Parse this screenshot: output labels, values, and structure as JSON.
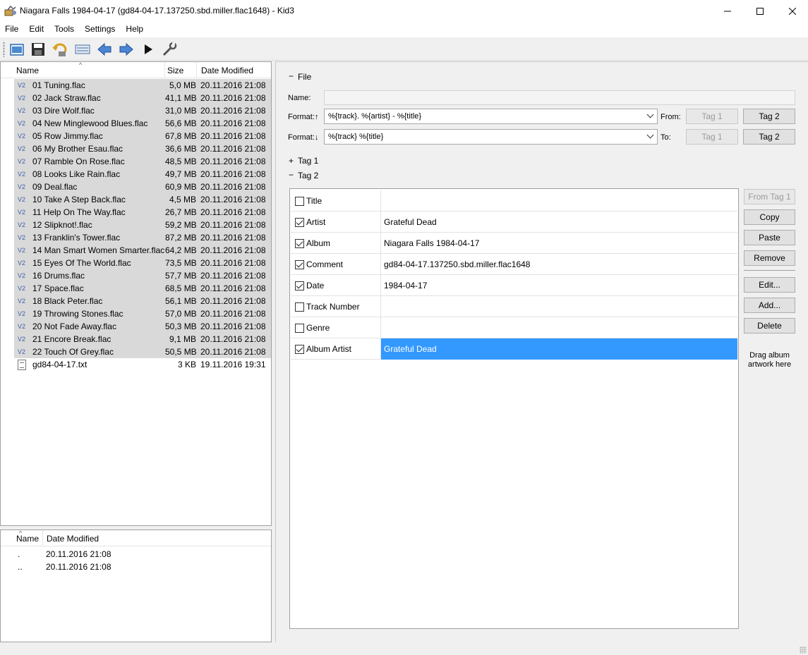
{
  "window": {
    "title": "Niagara Falls 1984-04-17 (gd84-04-17.137250.sbd.miller.flac1648) - Kid3"
  },
  "menu": [
    "File",
    "Edit",
    "Tools",
    "Settings",
    "Help"
  ],
  "toolbar": {
    "icons": [
      "open-icon",
      "save-icon",
      "revert-icon",
      "toggle-view-icon",
      "previous-icon",
      "next-icon",
      "play-icon",
      "settings-icon"
    ]
  },
  "file_list": {
    "columns": [
      "Name",
      "Size",
      "Date Modified"
    ],
    "rows": [
      {
        "tag": "V2",
        "name": "01 Tuning.flac",
        "size": "5,0 MB",
        "date": "20.11.2016 21:08"
      },
      {
        "tag": "V2",
        "name": "02 Jack Straw.flac",
        "size": "41,1 MB",
        "date": "20.11.2016 21:08"
      },
      {
        "tag": "V2",
        "name": "03 Dire Wolf.flac",
        "size": "31,0 MB",
        "date": "20.11.2016 21:08"
      },
      {
        "tag": "V2",
        "name": "04 New Minglewood Blues.flac",
        "size": "56,6 MB",
        "date": "20.11.2016 21:08"
      },
      {
        "tag": "V2",
        "name": "05 Row Jimmy.flac",
        "size": "67,8 MB",
        "date": "20.11.2016 21:08"
      },
      {
        "tag": "V2",
        "name": "06 My Brother Esau.flac",
        "size": "36,6 MB",
        "date": "20.11.2016 21:08"
      },
      {
        "tag": "V2",
        "name": "07 Ramble On Rose.flac",
        "size": "48,5 MB",
        "date": "20.11.2016 21:08"
      },
      {
        "tag": "V2",
        "name": "08 Looks Like Rain.flac",
        "size": "49,7 MB",
        "date": "20.11.2016 21:08"
      },
      {
        "tag": "V2",
        "name": "09 Deal.flac",
        "size": "60,9 MB",
        "date": "20.11.2016 21:08"
      },
      {
        "tag": "V2",
        "name": "10 Take A Step Back.flac",
        "size": "4,5 MB",
        "date": "20.11.2016 21:08"
      },
      {
        "tag": "V2",
        "name": "11 Help On The Way.flac",
        "size": "26,7 MB",
        "date": "20.11.2016 21:08"
      },
      {
        "tag": "V2",
        "name": "12 Slipknot!.flac",
        "size": "59,2 MB",
        "date": "20.11.2016 21:08"
      },
      {
        "tag": "V2",
        "name": "13 Franklin's Tower.flac",
        "size": "87,2 MB",
        "date": "20.11.2016 21:08"
      },
      {
        "tag": "V2",
        "name": "14 Man Smart Women Smarter.flac",
        "size": "64,2 MB",
        "date": "20.11.2016 21:08"
      },
      {
        "tag": "V2",
        "name": "15 Eyes Of The World.flac",
        "size": "73,5 MB",
        "date": "20.11.2016 21:08"
      },
      {
        "tag": "V2",
        "name": "16 Drums.flac",
        "size": "57,7 MB",
        "date": "20.11.2016 21:08"
      },
      {
        "tag": "V2",
        "name": "17 Space.flac",
        "size": "68,5 MB",
        "date": "20.11.2016 21:08"
      },
      {
        "tag": "V2",
        "name": "18 Black Peter.flac",
        "size": "56,1 MB",
        "date": "20.11.2016 21:08"
      },
      {
        "tag": "V2",
        "name": "19 Throwing Stones.flac",
        "size": "57,0 MB",
        "date": "20.11.2016 21:08"
      },
      {
        "tag": "V2",
        "name": "20 Not Fade Away.flac",
        "size": "50,3 MB",
        "date": "20.11.2016 21:08"
      },
      {
        "tag": "V2",
        "name": "21 Encore Break.flac",
        "size": "9,1 MB",
        "date": "20.11.2016 21:08"
      },
      {
        "tag": "V2",
        "name": "22 Touch Of Grey.flac",
        "size": "50,5 MB",
        "date": "20.11.2016 21:08"
      },
      {
        "tag": "",
        "name": "gd84-04-17.txt",
        "size": "3 KB",
        "date": "19.11.2016 19:31"
      }
    ]
  },
  "dir_list": {
    "columns": [
      "Name",
      "Date Modified"
    ],
    "rows": [
      {
        "name": ".",
        "date": "20.11.2016 21:08"
      },
      {
        "name": "..",
        "date": "20.11.2016 21:08"
      }
    ]
  },
  "file_section": {
    "toggle": "−",
    "title": "File",
    "name_label": "Name:",
    "name_value": "",
    "format_from_label": "Format:↑",
    "format_from_value": "%{track}. %{artist} - %{title}",
    "from_label": "From:",
    "format_to_label": "Format:↓",
    "format_to_value": "%{track} %{title}",
    "to_label": "To:",
    "tag1_btn": "Tag 1",
    "tag2_btn": "Tag 2"
  },
  "tag1_section": {
    "toggle": "+",
    "title": "Tag 1"
  },
  "tag2_section": {
    "toggle": "−",
    "title": "Tag 2"
  },
  "tag_frames": [
    {
      "name": "Title",
      "checked": false,
      "value": ""
    },
    {
      "name": "Artist",
      "checked": true,
      "value": "Grateful Dead"
    },
    {
      "name": "Album",
      "checked": true,
      "value": "Niagara Falls 1984-04-17"
    },
    {
      "name": "Comment",
      "checked": true,
      "value": "gd84-04-17.137250.sbd.miller.flac1648"
    },
    {
      "name": "Date",
      "checked": true,
      "value": "1984-04-17"
    },
    {
      "name": "Track Number",
      "checked": false,
      "value": ""
    },
    {
      "name": "Genre",
      "checked": false,
      "value": ""
    },
    {
      "name": "Album Artist",
      "checked": true,
      "value": "Grateful Dead",
      "selected": true
    }
  ],
  "tag_buttons": {
    "from_tag1": "From Tag 1",
    "copy": "Copy",
    "paste": "Paste",
    "remove": "Remove",
    "edit": "Edit...",
    "add": "Add...",
    "delete": "Delete"
  },
  "artwork_hint": "Drag album artwork here",
  "colors": {
    "selection": "#3399ff",
    "file_selection": "#d9d9d9",
    "tag_icon": "#3c5fa8"
  }
}
